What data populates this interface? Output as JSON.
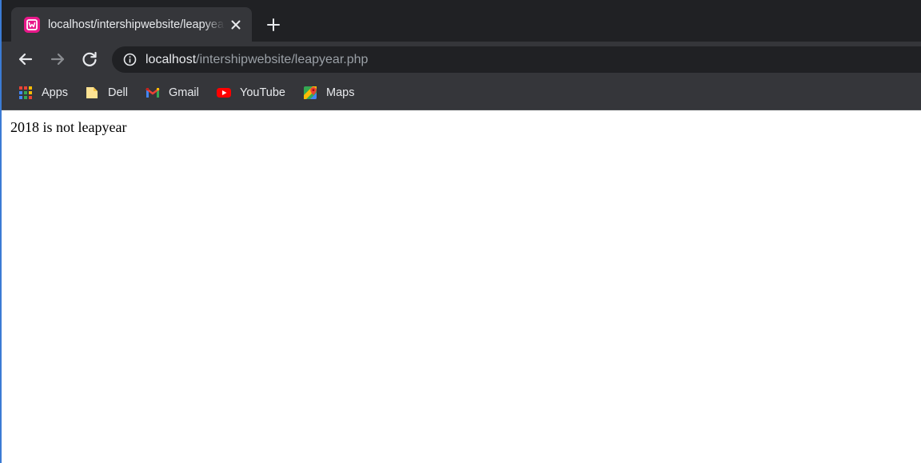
{
  "tab": {
    "title": "localhost/intershipwebsite/leapyear.php",
    "favicon": "wamp-server-icon",
    "accent_color": "#e8188a"
  },
  "address_bar": {
    "host": "localhost",
    "path": "/intershipwebsite/leapyear.php"
  },
  "bookmarks": [
    {
      "label": "Apps",
      "icon": "apps-grid-icon"
    },
    {
      "label": "Dell",
      "icon": "folder-icon"
    },
    {
      "label": "Gmail",
      "icon": "gmail-icon"
    },
    {
      "label": "YouTube",
      "icon": "youtube-icon"
    },
    {
      "label": "Maps",
      "icon": "maps-icon"
    }
  ],
  "page": {
    "text": "2018 is not leapyear"
  },
  "colors": {
    "tabstrip_bg": "#202124",
    "toolbar_bg": "#35363a",
    "omnibox_bg": "#202124",
    "page_bg": "#ffffff"
  }
}
